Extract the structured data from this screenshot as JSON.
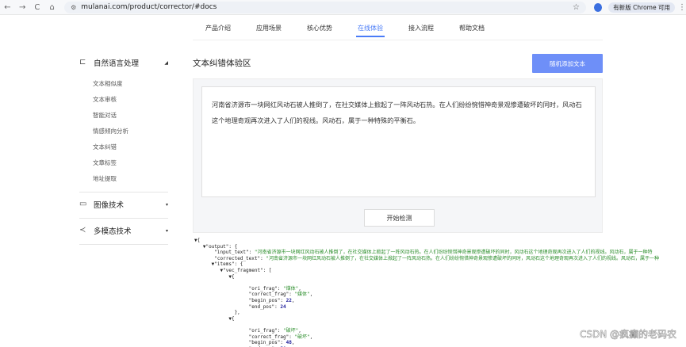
{
  "browser": {
    "back": "←",
    "forward": "→",
    "reload": "C",
    "home": "⌂",
    "url": "mulanai.com/product/corrector/#docs",
    "update_label": "有新版 Chrome 可用"
  },
  "topnav": {
    "items": [
      "产品介绍",
      "应用场景",
      "核心优势",
      "在线体验",
      "接入流程",
      "帮助文档"
    ],
    "active_index": 3
  },
  "sidebar": {
    "section1": {
      "label": "自然语言处理",
      "icon": "nlp-icon"
    },
    "subitems": [
      "文本相似度",
      "文本审核",
      "智能对话",
      "情感倾向分析",
      "文本纠错",
      "文章标签",
      "地址提取"
    ],
    "section2": {
      "label": "图像技术",
      "icon": "image-icon"
    },
    "section3": {
      "label": "多模态技术",
      "icon": "multimodal-icon"
    }
  },
  "main": {
    "title": "文本纠错体验区",
    "random_button": "随机添加文本",
    "input_text": "河南省济源市一块网红风动石被人推倒了，在社交媒体上掀起了一阵风动石热。在人们纷纷惋惜神奇景观惨遭破坏的同时，风动石这个地理奇观再次进入了人们的视线。风动石，属于一种特殊的平衡石。",
    "detect_button": "开始检测"
  },
  "json_output": {
    "l1": "{",
    "l2_key": "\"output\": {",
    "input_text_key": "\"input_text\": ",
    "input_text_val": "\"河南省济源市一块网红风动石被人推倒了，在社交媒体上掀起了一阵风动石热。在人们纷纷惋惜神奇景观惨遭破坏的同时，风动石这个地理奇观再次进入了人们的视线。风动石，属于一种特",
    "corrected_text_key": "\"corrected_text\": ",
    "corrected_text_val": "\"河南省济源市一块网红风动石被人推倒了，在社交媒体上掀起了一阵风动石热。在人们纷纷惋惜神奇景观惨遭破坏的同时，风动石这个地理奇观再次进入了人们的视线。风动石，属于一种",
    "items_key": "\"items\": {",
    "vec_key": "\"vec_fragment\": [",
    "frag1": {
      "ori": "\"煤体\"",
      "correct": "\"媒体\"",
      "begin": "22",
      "end": "24"
    },
    "frag2": {
      "ori": "\"破坏\"",
      "correct": "\"破坏\"",
      "begin": "48",
      "end": "50"
    }
  },
  "watermark": "CSDN @疯癫的老码农"
}
